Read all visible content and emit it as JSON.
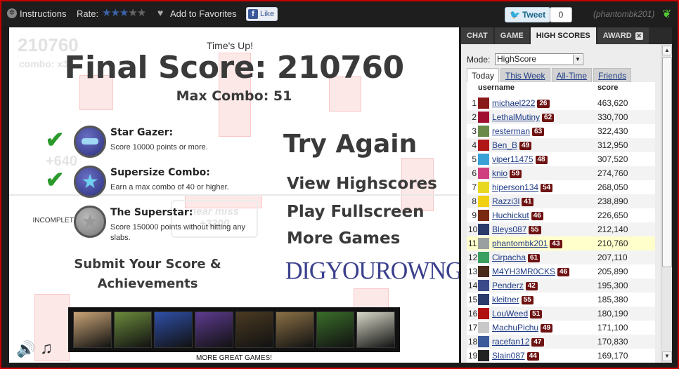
{
  "topbar": {
    "instructions": "Instructions",
    "rate_label": "Rate:",
    "rating": 3,
    "rating_max": 5,
    "favorites": "Add to Favorites",
    "fb_like": "Like",
    "tweet": "Tweet",
    "tweet_count": "0",
    "username": "(phantombk201)"
  },
  "game": {
    "ghost_score": "210760",
    "ghost_combo": "combo: x33",
    "ghost_plus": "+640",
    "ghost_near": "near miss",
    "ghost_near_value": "+3200",
    "times_up": "Time's Up!",
    "final_score": "Final Score: 210760",
    "max_combo": "Max Combo: 51",
    "achievements": [
      {
        "status": "complete",
        "title": "Star Gazer:",
        "desc": "Score 10000 points or more.",
        "icon": "star-gazer-medal-icon"
      },
      {
        "status": "complete",
        "title": "Supersize Combo:",
        "desc": "Earn a max combo of 40 or higher.",
        "icon": "supersize-combo-medal-icon"
      },
      {
        "status": "INCOMPLETE",
        "title": "The Superstar:",
        "desc": "Score 150000 points without hitting any slabs.",
        "icon": "superstar-medal-icon"
      }
    ],
    "submit_line1": "Submit Your Score &",
    "submit_line2": "Achievements",
    "try_again": "Try Again",
    "view_highscores": "View Highscores",
    "play_fullscreen": "Play Fullscreen",
    "more_games": "More Games",
    "dig_your_own_grave": "DIGYOUROWNGRAVE",
    "more_great_games": "MORE GREAT GAMES!",
    "thumbnail_colors": [
      "#c9a476",
      "#6b8a3c",
      "#2f4fa8",
      "#5d3b8f",
      "#4a3a22",
      "#8a7045",
      "#3a6d2a",
      "#d8d8c8"
    ]
  },
  "panel": {
    "tabs": [
      "CHAT",
      "GAME",
      "HIGH SCORES",
      "AWARD"
    ],
    "active_tab": "HIGH SCORES",
    "mode_label": "Mode:",
    "mode_value": "HighScore",
    "subtabs": [
      "Today",
      "This Week",
      "All-Time",
      "Friends"
    ],
    "active_subtab": "Today",
    "col_username": "username",
    "col_score": "score",
    "rows": [
      {
        "rank": "1",
        "name": "michael222",
        "level": "26",
        "score": "463,620",
        "avatar": "#8a1a1a"
      },
      {
        "rank": "2",
        "name": "LethalMutiny",
        "level": "62",
        "score": "330,700",
        "avatar": "#a01030"
      },
      {
        "rank": "3",
        "name": "resterman",
        "level": "63",
        "score": "322,430",
        "avatar": "#6a8a4a"
      },
      {
        "rank": "4",
        "name": "Ben_B",
        "level": "49",
        "score": "312,950",
        "avatar": "#b01818"
      },
      {
        "rank": "5",
        "name": "viper11475",
        "level": "48",
        "score": "307,520",
        "avatar": "#3aa0d8"
      },
      {
        "rank": "6",
        "name": "knio",
        "level": "59",
        "score": "274,760",
        "avatar": "#d04080"
      },
      {
        "rank": "7",
        "name": "hiperson134",
        "level": "54",
        "score": "268,050",
        "avatar": "#e8d820"
      },
      {
        "rank": "8",
        "name": "Razzi3l",
        "level": "41",
        "score": "238,890",
        "avatar": "#f0d010"
      },
      {
        "rank": "9",
        "name": "Huchickut",
        "level": "46",
        "score": "226,650",
        "avatar": "#7a2a10"
      },
      {
        "rank": "10",
        "name": "Bleys087",
        "level": "55",
        "score": "212,140",
        "avatar": "#2a3a6a"
      },
      {
        "rank": "11",
        "name": "phantombk201",
        "level": "43",
        "score": "210,760",
        "avatar": "#9aa0a0"
      },
      {
        "rank": "12",
        "name": "Cirpacha",
        "level": "61",
        "score": "207,110",
        "avatar": "#3aa060"
      },
      {
        "rank": "13",
        "name": "M4YH3MR0CKS",
        "level": "46",
        "score": "205,890",
        "avatar": "#4a2a1a"
      },
      {
        "rank": "14",
        "name": "Penderz",
        "level": "42",
        "score": "195,300",
        "avatar": "#3a4a8a"
      },
      {
        "rank": "15",
        "name": "kleitner",
        "level": "55",
        "score": "185,380",
        "avatar": "#2a3a6a"
      },
      {
        "rank": "16",
        "name": "LouWeed",
        "level": "51",
        "score": "180,190",
        "avatar": "#b01010"
      },
      {
        "rank": "17",
        "name": "MachuPichu",
        "level": "49",
        "score": "171,100",
        "avatar": "#c8c8c8"
      },
      {
        "rank": "18",
        "name": "racefan12",
        "level": "47",
        "score": "170,830",
        "avatar": "#3a5a9a"
      },
      {
        "rank": "19",
        "name": "Slain087",
        "level": "44",
        "score": "169,170",
        "avatar": "#222222"
      }
    ]
  }
}
